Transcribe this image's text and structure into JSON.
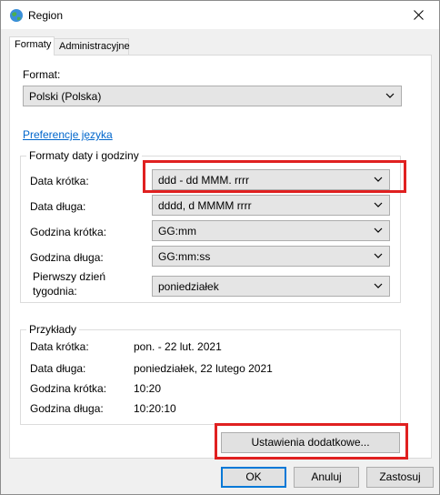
{
  "window": {
    "title": "Region"
  },
  "tabs": [
    {
      "label": "Formaty"
    },
    {
      "label": "Administracyjne"
    }
  ],
  "format": {
    "label": "Format:",
    "value": "Polski (Polska)"
  },
  "preferences_link": "Preferencje języka",
  "date_time_formats": {
    "title": "Formaty daty i godziny",
    "rows": [
      {
        "label": "Data krótka:",
        "value": "ddd - dd MMM. rrrr"
      },
      {
        "label": "Data długa:",
        "value": "dddd, d MMMM rrrr"
      },
      {
        "label": "Godzina krótka:",
        "value": "GG:mm"
      },
      {
        "label": "Godzina długa:",
        "value": "GG:mm:ss"
      },
      {
        "label": "Pierwszy dzień\ntygodnia:",
        "value": "poniedziałek"
      }
    ]
  },
  "examples": {
    "title": "Przykłady",
    "rows": [
      {
        "label": "Data krótka:",
        "value": "pon. - 22 lut. 2021"
      },
      {
        "label": "Data długa:",
        "value": "poniedziałek, 22 lutego 2021"
      },
      {
        "label": "Godzina krótka:",
        "value": "10:20"
      },
      {
        "label": "Godzina długa:",
        "value": "10:20:10"
      }
    ]
  },
  "additional_settings_button": "Ustawienia dodatkowe...",
  "footer": {
    "ok": "OK",
    "cancel": "Anuluj",
    "apply": "Zastosuj"
  },
  "colors": {
    "highlight": "#e02020",
    "link": "#0066cc",
    "default_button_border": "#0078d7"
  }
}
